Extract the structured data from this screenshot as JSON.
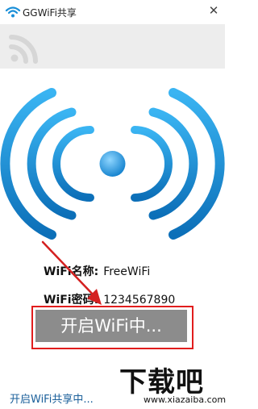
{
  "window": {
    "title": "GGWiFi共享",
    "close_glyph": "✕",
    "app_icon": "wifi-icon"
  },
  "header": {
    "icon": "wifi-icon"
  },
  "hero": {
    "icon": "wifi-broadcast-icon",
    "accent": "#1a9be0"
  },
  "info": {
    "name_label": "WiFi名称:",
    "name_value": "FreeWiFi",
    "password_label": "WiFi密码:",
    "password_value": "1234567890"
  },
  "actions": {
    "start_label": "开启WiFi中..."
  },
  "status": {
    "text": "开启WiFi共享中..."
  },
  "watermark": {
    "brand": "下载吧",
    "url": "www.xiazaiba.com"
  },
  "colors": {
    "button_bg": "#8c8c8c",
    "highlight": "#e11d1d",
    "status_text": "#1a5f9a",
    "header_band": "#ededed"
  }
}
